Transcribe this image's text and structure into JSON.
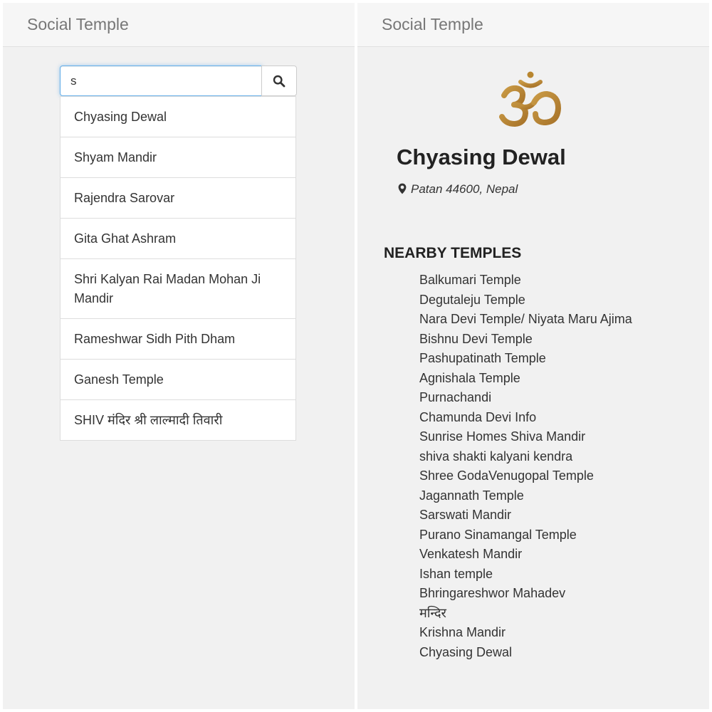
{
  "left_panel": {
    "navbar": {
      "brand": "Social Temple"
    },
    "search": {
      "value": "s",
      "button_icon": "search-icon"
    },
    "results": [
      "Chyasing Dewal",
      "Shyam Mandir",
      "Rajendra Sarovar",
      "Gita Ghat Ashram",
      "Shri Kalyan Rai Madan Mohan Ji Mandir",
      "Rameshwar Sidh Pith Dham",
      "Ganesh Temple",
      "SHIV मंदिर श्री लाल्मादी तिवारी"
    ]
  },
  "right_panel": {
    "navbar": {
      "brand": "Social Temple"
    },
    "symbol": {
      "icon": "om-symbol-icon",
      "color": "#b8862f"
    },
    "temple": {
      "name": "Chyasing Dewal",
      "location_icon": "map-marker-icon",
      "location": "Patan 44600, Nepal"
    },
    "nearby": {
      "heading": "NEARBY TEMPLES",
      "items": [
        "Balkumari Temple",
        "Degutaleju Temple",
        "Nara Devi Temple/ Niyata Maru Ajima",
        "Bishnu Devi Temple",
        "Pashupatinath Temple",
        "Agnishala Temple",
        "Purnachandi",
        "Chamunda Devi Info",
        "Sunrise Homes Shiva Mandir",
        "shiva shakti kalyani kendra",
        "Shree GodaVenugopal Temple",
        "Jagannath Temple",
        "Sarswati Mandir",
        "Purano Sinamangal Temple",
        "Venkatesh Mandir",
        "Ishan temple",
        "Bhringareshwor Mahadev",
        "मन्दिर",
        "Krishna Mandir",
        "Chyasing Dewal"
      ]
    }
  }
}
